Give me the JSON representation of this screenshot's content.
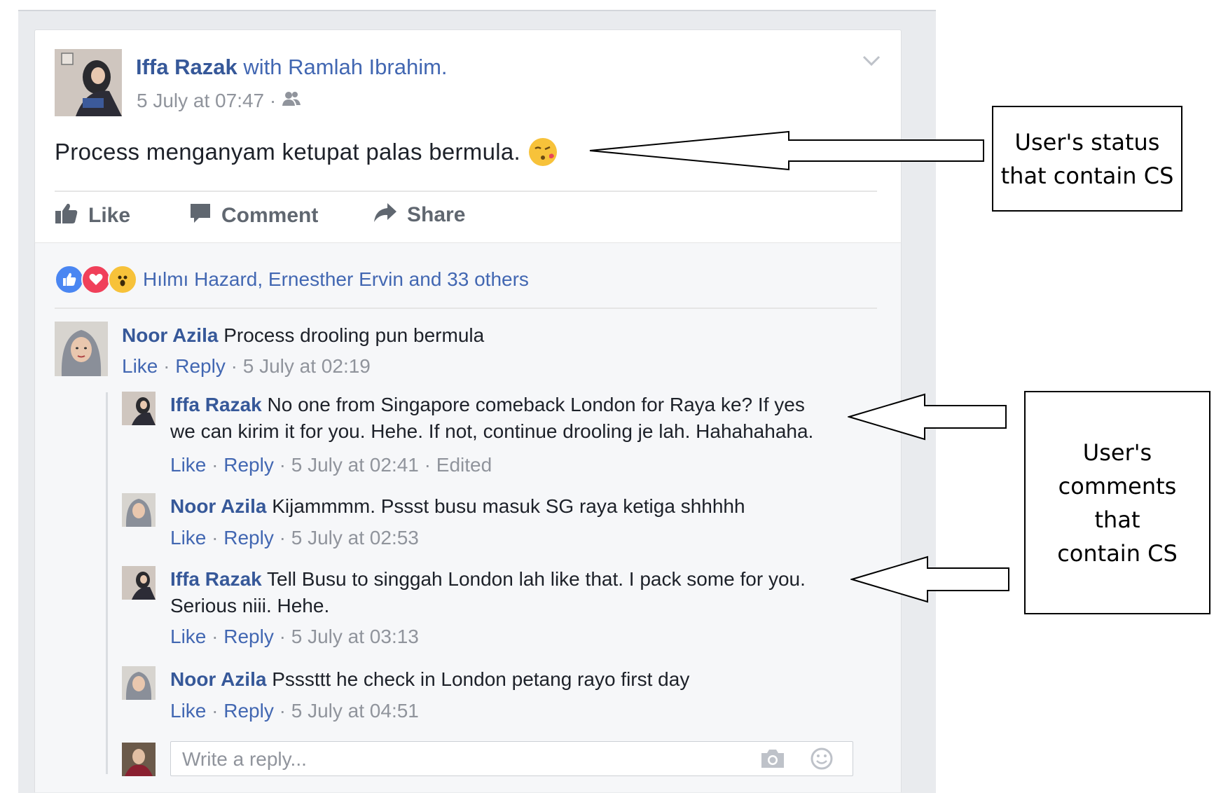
{
  "post": {
    "author": "Iffa Razak",
    "with_text": "with",
    "tagged": "Ramlah Ibrahim.",
    "timestamp": "5 July at 07:47 ·",
    "status_text": "Process menganyam ketupat palas bermula.",
    "actions": {
      "like": "Like",
      "comment": "Comment",
      "share": "Share"
    }
  },
  "reactions": {
    "summary": "Hılmı Hazard, Ernesther Ervin and 33 others",
    "types": [
      "like",
      "love",
      "wow"
    ]
  },
  "comments": [
    {
      "author": "Noor Azila",
      "text": "Process drooling pun bermula",
      "like": "Like",
      "reply": "Reply",
      "time": "5 July at 02:19",
      "edited": ""
    }
  ],
  "replies": [
    {
      "author": "Iffa Razak",
      "text_line1": "No one from Singapore comeback London for Raya ke? If yes",
      "text_line2": "we can kirim it for you. Hehe. If not, continue drooling je lah. Hahahahaha.",
      "like": "Like",
      "reply": "Reply",
      "time": "5 July at 02:41",
      "edited": "Edited"
    },
    {
      "author": "Noor Azila",
      "text_line1": "Kijammmm. Pssst busu masuk SG raya ketiga shhhhh",
      "like": "Like",
      "reply": "Reply",
      "time": "5 July at 02:53"
    },
    {
      "author": "Iffa Razak",
      "text_line1": "Tell Busu to singgah London lah like that. I pack some for you.",
      "text_line2": "Serious niii. Hehe.",
      "like": "Like",
      "reply": "Reply",
      "time": "5 July at 03:13"
    },
    {
      "author": "Noor Azila",
      "text_line1": "Psssttt he check in London petang rayo first day",
      "like": "Like",
      "reply": "Reply",
      "time": "5 July at 04:51"
    }
  ],
  "reply_box": {
    "placeholder": "Write a reply..."
  },
  "callouts": {
    "status": [
      "User's status",
      "that contain CS"
    ],
    "comments": [
      "User's",
      "comments",
      "that",
      "contain CS"
    ]
  },
  "colors": {
    "name_blue": "#365899",
    "link_blue": "#4267b2",
    "meta_gray": "#90949c",
    "feed_bg": "#e9ebee"
  },
  "icons": [
    "chevron-down-icon",
    "friends-audience-icon",
    "kissing-face-emoji-icon",
    "thumbs-up-icon",
    "comment-icon",
    "share-icon",
    "like-reaction-icon",
    "love-reaction-icon",
    "wow-reaction-icon",
    "camera-icon",
    "smiley-icon"
  ]
}
